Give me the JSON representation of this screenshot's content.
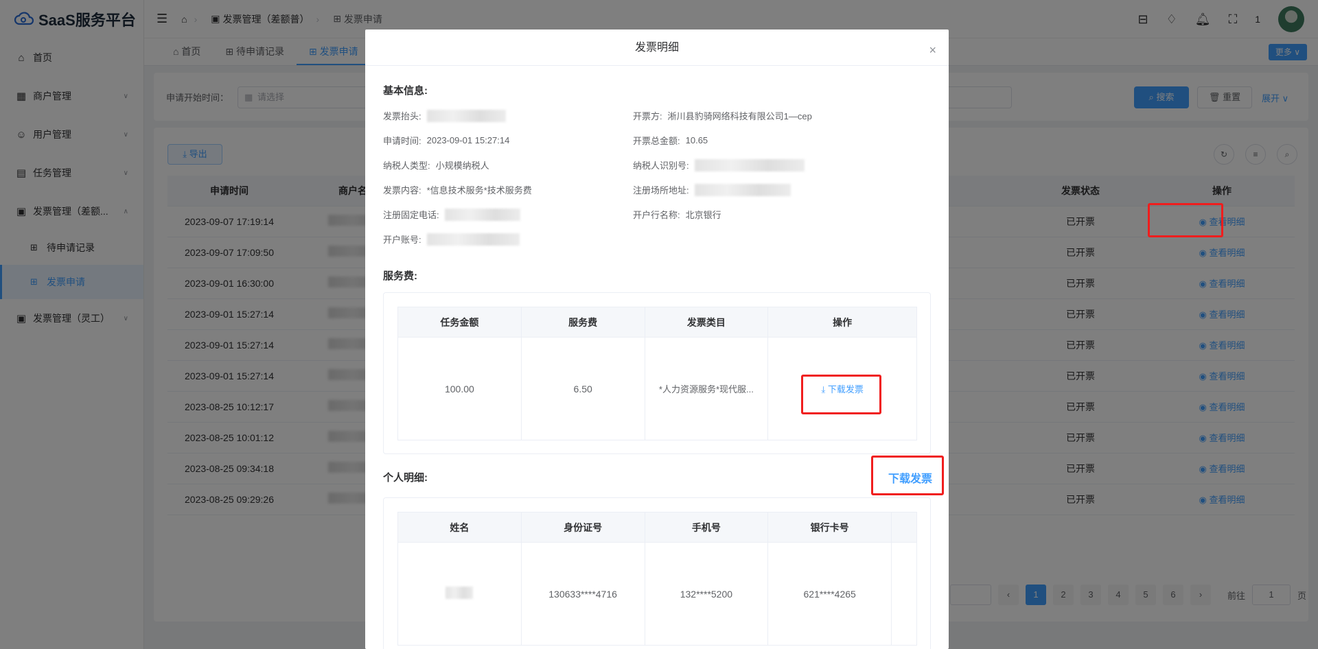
{
  "app": {
    "logo_text": "SaaS服务平台"
  },
  "sidebar": {
    "items": [
      {
        "label": "首页",
        "icon": "home-icon"
      },
      {
        "label": "商户管理",
        "icon": "store-icon"
      },
      {
        "label": "用户管理",
        "icon": "user-icon"
      },
      {
        "label": "任务管理",
        "icon": "task-icon"
      },
      {
        "label": "发票管理（差额...",
        "icon": "invoice-icon"
      },
      {
        "label": "发票管理（灵工）",
        "icon": "invoice-icon"
      }
    ],
    "sub_items": [
      {
        "label": "待申请记录"
      },
      {
        "label": "发票申请"
      }
    ]
  },
  "header": {
    "breadcrumb": [
      "发票管理（差额普）",
      "发票申请"
    ],
    "badge_count": "1"
  },
  "tabs": [
    "首页",
    "待申请记录",
    "发票申请"
  ],
  "more_label": "更多",
  "search": {
    "label": "申请开始时间：",
    "placeholder": "请选择",
    "search_button": "搜索",
    "reset_button": "重置",
    "expand_link": "展开"
  },
  "list": {
    "export_button": "导出",
    "columns": [
      "申请时间",
      "商户名",
      "发票状态",
      "操作"
    ],
    "rows": [
      {
        "time": "2023-09-07 17:19:14",
        "status": "已开票",
        "action": "查看明细"
      },
      {
        "time": "2023-09-07 17:09:50",
        "status": "已开票",
        "action": "查看明细"
      },
      {
        "time": "2023-09-01 16:30:00",
        "status": "已开票",
        "action": "查看明细"
      },
      {
        "time": "2023-09-01 15:27:14",
        "status": "已开票",
        "action": "查看明细"
      },
      {
        "time": "2023-09-01 15:27:14",
        "status": "已开票",
        "action": "查看明细"
      },
      {
        "time": "2023-09-01 15:27:14",
        "status": "已开票",
        "action": "查看明细"
      },
      {
        "time": "2023-08-25 10:12:17",
        "status": "已开票",
        "action": "查看明细"
      },
      {
        "time": "2023-08-25 10:01:12",
        "status": "已开票",
        "action": "查看明细"
      },
      {
        "time": "2023-08-25 09:34:18",
        "status": "已开票",
        "action": "查看明细"
      },
      {
        "time": "2023-08-25 09:29:26",
        "status": "已开票",
        "action": "查看明细"
      }
    ]
  },
  "pagination": {
    "pages": [
      "1",
      "2",
      "3",
      "4",
      "5",
      "6"
    ],
    "current": "1",
    "goto_label": "前往",
    "goto_value": "1",
    "page_suffix": "页"
  },
  "modal": {
    "title": "发票明细",
    "basic_title": "基本信息:",
    "basic": {
      "invoice_header_label": "发票抬头:",
      "issuer_label": "开票方:",
      "issuer_value": "淅川县豹骑网络科技有限公司1—cep",
      "apply_time_label": "申请时间:",
      "apply_time_value": "2023-09-01 15:27:14",
      "total_label": "开票总金额:",
      "total_value": "10.65",
      "taxpayer_type_label": "纳税人类型:",
      "taxpayer_type_value": "小规模纳税人",
      "taxpayer_id_label": "纳税人识别号:",
      "content_label": "发票内容:",
      "content_value": "*信息技术服务*技术服务费",
      "address_label": "注册场所地址:",
      "phone_label": "注册固定电话:",
      "bank_label": "开户行名称:",
      "bank_value": "北京银行",
      "account_label": "开户账号:"
    },
    "service_title": "服务费:",
    "service_table": {
      "columns": [
        "任务金额",
        "服务费",
        "发票类目",
        "操作"
      ],
      "row": {
        "amount": "100.00",
        "fee": "6.50",
        "category": "*人力资源服务*现代服...",
        "action": "下载发票"
      }
    },
    "personal_title": "个人明细:",
    "personal_download": "下载发票",
    "personal_table": {
      "columns": [
        "姓名",
        "身份证号",
        "手机号",
        "银行卡号"
      ],
      "row": {
        "id": "130633****4716",
        "phone": "132****5200",
        "card": "621****4265"
      }
    }
  }
}
